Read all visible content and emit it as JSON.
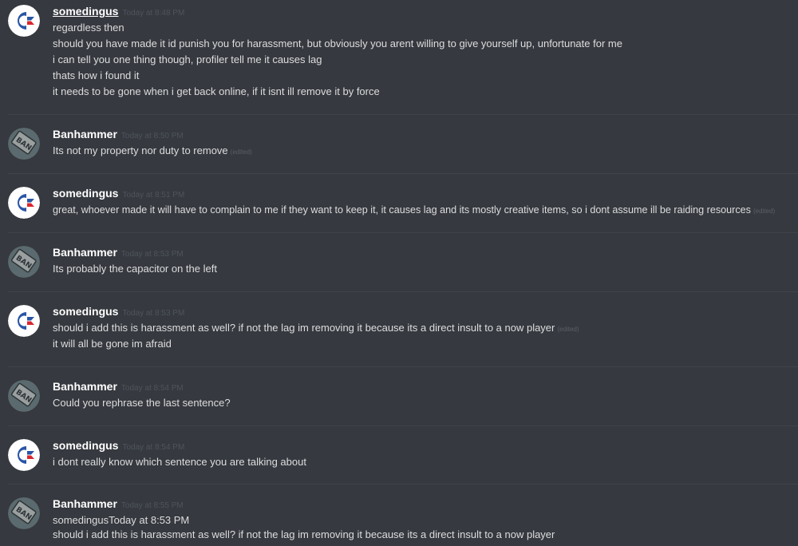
{
  "messages": [
    {
      "author": "somedingus",
      "avatar": "commodore-avatar",
      "time": "Today at 8:48 PM",
      "lines": [
        {
          "text": "regardless then",
          "edited": ""
        },
        {
          "text": "should you have made it id punish you for harassment, but obviously you arent willing to give yourself up, unfortunate for me",
          "edited": ""
        },
        {
          "text": "i can tell you one thing though, profiler tell me it causes lag",
          "edited": ""
        },
        {
          "text": "thats how i found it",
          "edited": ""
        },
        {
          "text": "it needs to be gone when i get back online, if it isnt ill remove it by force",
          "edited": ""
        }
      ]
    },
    {
      "author": "Banhammer",
      "avatar": "ban-hammer-avatar",
      "time": "Today at 8:50 PM",
      "lines": [
        {
          "text": "Its not my property nor duty to remove",
          "edited": "(edited)"
        }
      ]
    },
    {
      "author": "somedingus",
      "avatar": "commodore-avatar",
      "time": "Today at 8:51 PM",
      "lines": [
        {
          "text": "great, whoever made it will have to complain to me if they want to keep it, it causes lag and its mostly creative items, so i dont assume ill be raiding resources",
          "edited": "(edited)"
        }
      ]
    },
    {
      "author": "Banhammer",
      "avatar": "ban-hammer-avatar",
      "time": "Today at 8:53 PM",
      "lines": [
        {
          "text": "Its probably the capacitor on the left",
          "edited": ""
        }
      ]
    },
    {
      "author": "somedingus",
      "avatar": "commodore-avatar",
      "time": "Today at 8:53 PM",
      "lines": [
        {
          "text": "should i add this is harassment as well? if not the lag im removing it because its a direct insult to a now player",
          "edited": "(edited)"
        },
        {
          "text": "it will all be gone im afraid",
          "edited": ""
        }
      ]
    },
    {
      "author": "Banhammer",
      "avatar": "ban-hammer-avatar",
      "time": "Today at 8:54 PM",
      "lines": [
        {
          "text": "Could you rephrase the last sentence?",
          "edited": ""
        }
      ]
    },
    {
      "author": "somedingus",
      "avatar": "commodore-avatar",
      "time": "Today at 8:54 PM",
      "lines": [
        {
          "text": "i dont really know which sentence you are talking about",
          "edited": ""
        }
      ]
    },
    {
      "author": "Banhammer",
      "avatar": "ban-hammer-avatar",
      "time": "Today at 8:55 PM",
      "lines": [
        {
          "text": "somedingusToday at 8:53 PM",
          "edited": ""
        },
        {
          "text": "should i add this is harassment as well? if not the lag im removing it because its a direct insult to a now player",
          "edited": ""
        }
      ]
    }
  ]
}
